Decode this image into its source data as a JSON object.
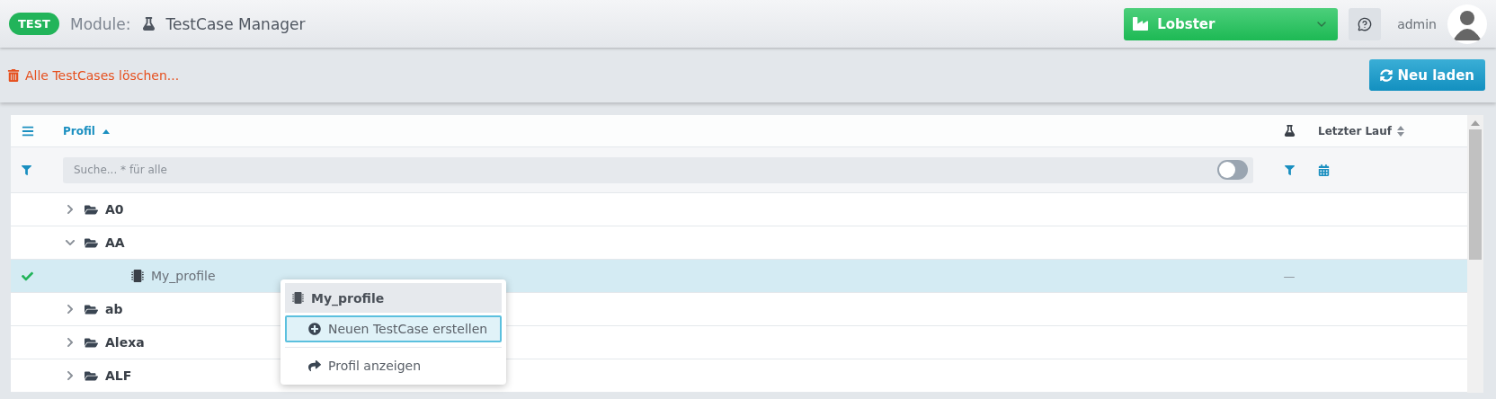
{
  "header": {
    "badge": "TEST",
    "module_label": "Module:",
    "module_name": "TestCase Manager",
    "project": "Lobster",
    "user": "admin"
  },
  "toolbar": {
    "delete_all": "Alle TestCases löschen...",
    "reload": "Neu laden"
  },
  "table": {
    "columns": [
      {
        "label": "Profil",
        "sorted": true
      },
      {
        "label": "Letzter Lauf",
        "sorted": false
      }
    ],
    "search": {
      "placeholder": "Suche... * für alle"
    },
    "toggle": {
      "on": false
    },
    "tree": [
      {
        "name": "A0",
        "kind": "folder",
        "expanded": false
      },
      {
        "name": "AA",
        "kind": "folder",
        "expanded": true,
        "children": [
          {
            "name": "My_profile",
            "kind": "profile",
            "selected": true,
            "checked": true,
            "flask": "—"
          }
        ]
      },
      {
        "name": "ab",
        "kind": "folder",
        "expanded": false
      },
      {
        "name": "Alexa",
        "kind": "folder",
        "expanded": false
      },
      {
        "name": "ALF",
        "kind": "folder",
        "expanded": false
      }
    ]
  },
  "context_menu": {
    "title": "My_profile",
    "items": [
      {
        "label": "Neuen TestCase erstellen",
        "kind": "add",
        "selected": true
      },
      {
        "label": "Profil anzeigen",
        "kind": "show",
        "selected": false
      }
    ]
  }
}
